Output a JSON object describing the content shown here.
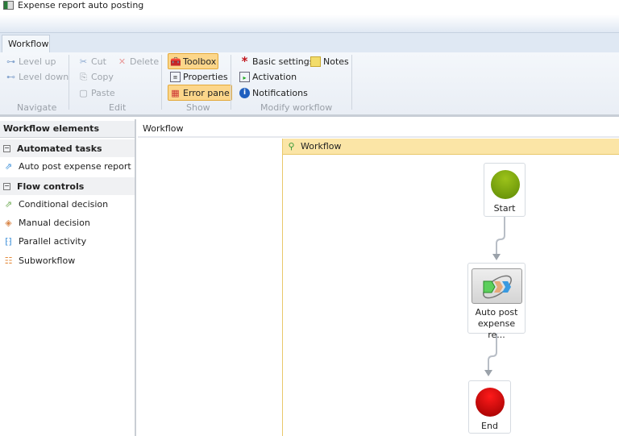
{
  "window": {
    "title": "Expense report auto posting"
  },
  "ribbon": {
    "tab": "Workflow",
    "navigate": {
      "label": "Navigate",
      "level_up": "Level up",
      "level_down": "Level down"
    },
    "edit": {
      "label": "Edit",
      "cut": "Cut",
      "delete": "Delete",
      "copy": "Copy",
      "paste": "Paste"
    },
    "show": {
      "label": "Show",
      "toolbox": "Toolbox",
      "properties": "Properties",
      "error_pane": "Error pane"
    },
    "modify": {
      "label": "Modify workflow",
      "basic_settings": "Basic settings",
      "notes": "Notes",
      "activation": "Activation",
      "notifications": "Notifications"
    }
  },
  "elements": {
    "title": "Workflow elements",
    "automated": {
      "label": "Automated tasks",
      "items": [
        "Auto post expense report"
      ]
    },
    "flow": {
      "label": "Flow controls",
      "items": [
        "Conditional decision",
        "Manual decision",
        "Parallel activity",
        "Subworkflow"
      ]
    }
  },
  "canvas": {
    "breadcrumb": "Workflow",
    "container_title": "Workflow",
    "nodes": {
      "start": "Start",
      "task_line1": "Auto post",
      "task_line2": "expense re...",
      "end": "End"
    }
  }
}
